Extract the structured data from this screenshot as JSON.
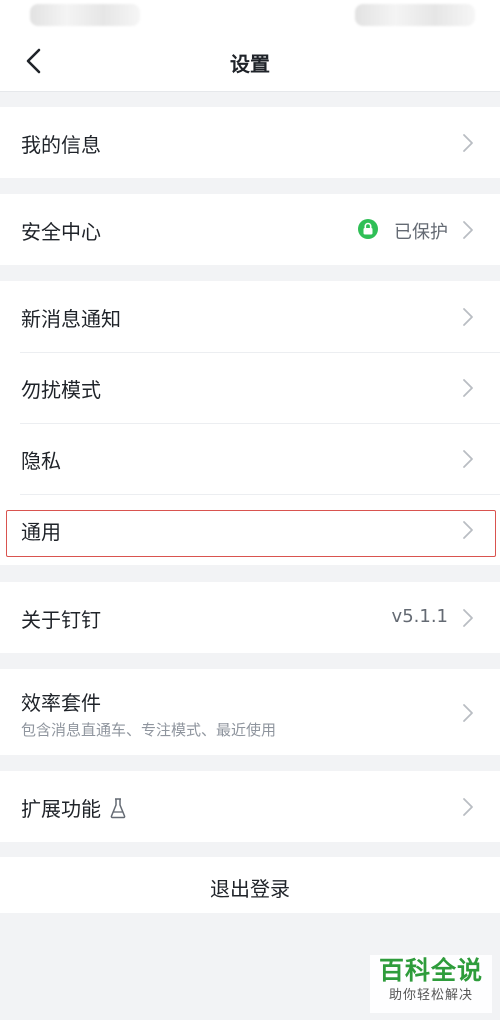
{
  "header": {
    "title": "设置"
  },
  "groups": {
    "g1": [
      {
        "label": "我的信息"
      }
    ],
    "g2": [
      {
        "label": "安全中心",
        "value": "已保护"
      }
    ],
    "g3": [
      {
        "label": "新消息通知"
      },
      {
        "label": "勿扰模式"
      },
      {
        "label": "隐私"
      },
      {
        "label": "通用"
      }
    ],
    "g4": [
      {
        "label": "关于钉钉",
        "value": "v5.1.1"
      }
    ],
    "g5": [
      {
        "label": "效率套件",
        "sub": "包含消息直通车、专注模式、最近使用"
      }
    ],
    "g6": [
      {
        "label": "扩展功能"
      }
    ]
  },
  "logout": {
    "label": "退出登录"
  },
  "watermark": {
    "title": "百科全说",
    "subtitle": "助你轻松解决"
  },
  "colors": {
    "status_green": "#2fbf56",
    "highlight_red": "#d9534f",
    "watermark_green": "#2e9c3b"
  },
  "icons": {
    "back": "chevron-left-icon",
    "row_arrow": "chevron-right-icon",
    "lock": "lock-icon",
    "lab": "flask-icon"
  }
}
